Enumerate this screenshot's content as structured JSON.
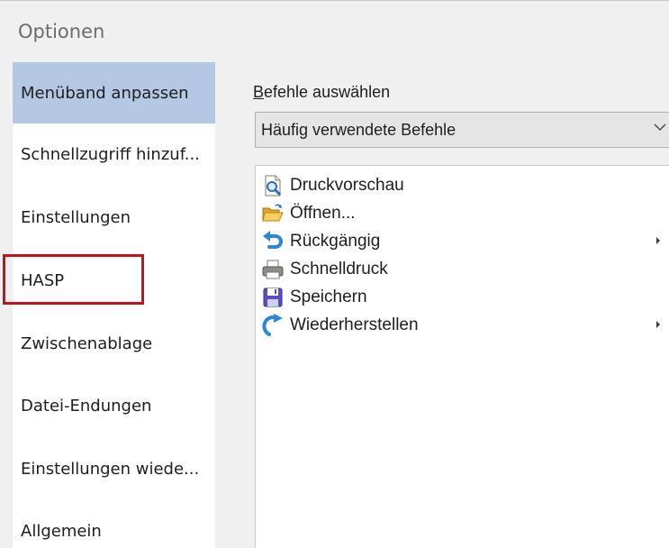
{
  "window": {
    "title": "Optionen"
  },
  "sidebar": {
    "items": [
      {
        "label": "Menüband anpassen",
        "selected": true
      },
      {
        "label": "Schnellzugriff hinzuf..."
      },
      {
        "label": "Einstellungen"
      },
      {
        "label": "HASP"
      },
      {
        "label": "Zwischenablage"
      },
      {
        "label": "Datei-Endungen"
      },
      {
        "label": "Einstellungen wiede..."
      },
      {
        "label": "Allgemein"
      }
    ]
  },
  "main": {
    "commands_label_accel": "B",
    "commands_label_rest": "efehle auswählen",
    "dropdown_value": "Häufig verwendete Befehle",
    "commands": [
      {
        "label": "Druckvorschau",
        "icon": "print-preview-icon",
        "has_submenu": false
      },
      {
        "label": "Öffnen...",
        "icon": "open-folder-icon",
        "has_submenu": false
      },
      {
        "label": "Rückgängig",
        "icon": "undo-icon",
        "has_submenu": true
      },
      {
        "label": "Schnelldruck",
        "icon": "quick-print-icon",
        "has_submenu": false
      },
      {
        "label": "Speichern",
        "icon": "save-icon",
        "has_submenu": false
      },
      {
        "label": "Wiederherstellen",
        "icon": "redo-icon",
        "has_submenu": true
      }
    ]
  },
  "colors": {
    "selected_background": "#b4c8e4",
    "highlight_border": "#c0141e"
  }
}
